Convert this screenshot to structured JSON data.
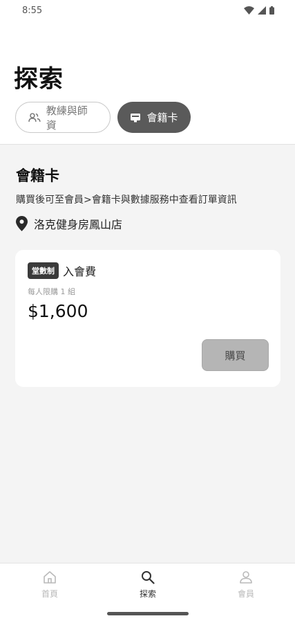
{
  "status_bar": {
    "time": "8:55"
  },
  "header": {
    "title": "探索"
  },
  "tabs": [
    {
      "label": "教練與師資",
      "icon": "people-icon",
      "active": false
    },
    {
      "label": "會籍卡",
      "icon": "card-icon",
      "active": true
    }
  ],
  "section": {
    "title": "會籍卡",
    "description": "購買後可至會員>會籍卡與數據服務中查看訂單資訊",
    "location": "洛克健身房鳳山店"
  },
  "card": {
    "badge": "堂數制",
    "name": "入會費",
    "limit": "每人限購 1 組",
    "price": "$1,600",
    "buy_label": "購買"
  },
  "bottom_nav": [
    {
      "label": "首頁",
      "icon": "home-icon",
      "active": false
    },
    {
      "label": "探索",
      "icon": "search-icon",
      "active": true
    },
    {
      "label": "會員",
      "icon": "person-icon",
      "active": false
    }
  ],
  "colors": {
    "active_tab": "#5a5a5a",
    "buy_button": "#b5b5b5",
    "background": "#f4f4f4"
  }
}
